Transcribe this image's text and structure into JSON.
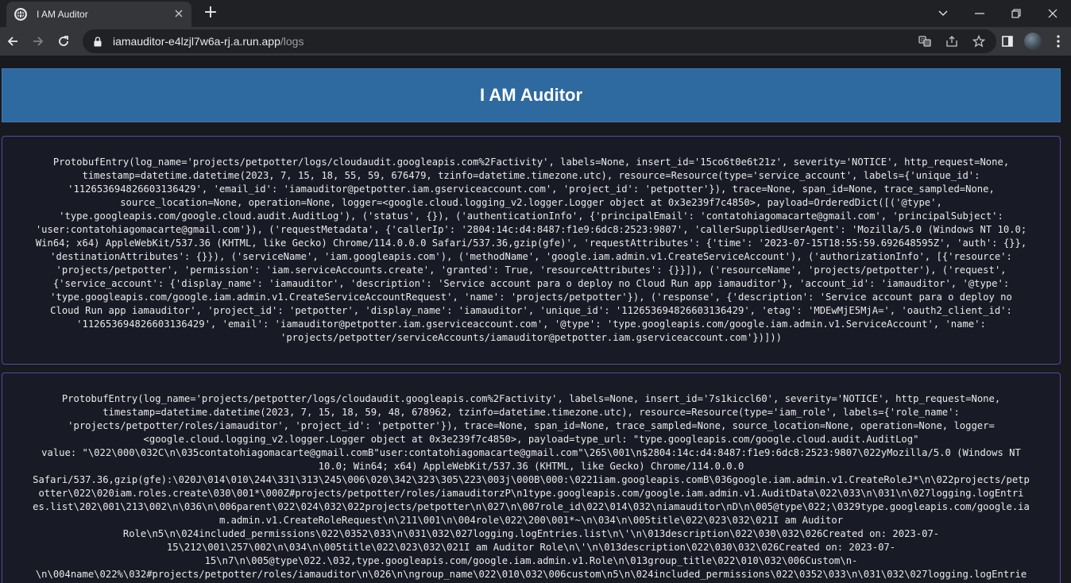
{
  "browser": {
    "tab_title": "I AM Auditor",
    "new_tab_label": "+",
    "url_host": "iamauditor-e4lzjl7w6a-rj.a.run.app",
    "url_path": "/logs"
  },
  "page": {
    "title": "I AM Auditor",
    "logs": [
      {
        "lines": [
          "ProtobufEntry(log_name='projects/petpotter/logs/cloudaudit.googleapis.com%2Factivity', labels=None, insert_id='15co6t0e6t21z', severity='NOTICE', http_request=None,",
          "timestamp=datetime.datetime(2023, 7, 15, 18, 55, 59, 676479, tzinfo=datetime.timezone.utc), resource=Resource(type='service_account', labels={'unique_id':",
          "'112653694826603136429', 'email_id': 'iamauditor@petpotter.iam.gserviceaccount.com', 'project_id': 'petpotter'}), trace=None, span_id=None, trace_sampled=None,",
          "source_location=None, operation=None, logger=<google.cloud.logging_v2.logger.Logger object at 0x3e239f7c4850>, payload=OrderedDict([('@type',",
          "'type.googleapis.com/google.cloud.audit.AuditLog'), ('status', {}), ('authenticationInfo', {'principalEmail': 'contatohiagomacarte@gmail.com', 'principalSubject':",
          "'user:contatohiagomacarte@gmail.com'}), ('requestMetadata', {'callerIp': '2804:14c:d4:8487:f1e9:6dc8:2523:9807', 'callerSuppliedUserAgent': 'Mozilla/5.0 (Windows NT 10.0;",
          "Win64; x64) AppleWebKit/537.36 (KHTML, like Gecko) Chrome/114.0.0.0 Safari/537.36,gzip(gfe)', 'requestAttributes': {'time': '2023-07-15T18:55:59.692648595Z', 'auth': {}},",
          "'destinationAttributes': {}}), ('serviceName', 'iam.googleapis.com'), ('methodName', 'google.iam.admin.v1.CreateServiceAccount'), ('authorizationInfo', [{'resource':",
          "'projects/petpotter', 'permission': 'iam.serviceAccounts.create', 'granted': True, 'resourceAttributes': {}}]), ('resourceName', 'projects/petpotter'), ('request',",
          "{'service_account': {'display_name': 'iamauditor', 'description': 'Service account para o deploy no Cloud Run app iamauditor'}, 'account_id': 'iamauditor', '@type':",
          "'type.googleapis.com/google.iam.admin.v1.CreateServiceAccountRequest', 'name': 'projects/petpotter'}), ('response', {'description': 'Service account para o deploy no",
          "Cloud Run app iamauditor', 'project_id': 'petpotter', 'display_name': 'iamauditor', 'unique_id': '112653694826603136429', 'etag': 'MDEwMjE5MjA=', 'oauth2_client_id':",
          "'112653694826603136429', 'email': 'iamauditor@petpotter.iam.gserviceaccount.com', '@type': 'type.googleapis.com/google.iam.admin.v1.ServiceAccount', 'name':",
          "'projects/petpotter/serviceAccounts/iamauditor@petpotter.iam.gserviceaccount.com'})]))"
        ]
      },
      {
        "lines": [
          "ProtobufEntry(log_name='projects/petpotter/logs/cloudaudit.googleapis.com%2Factivity', labels=None, insert_id='7s1kiccl60', severity='NOTICE', http_request=None,",
          "timestamp=datetime.datetime(2023, 7, 15, 18, 59, 48, 678962, tzinfo=datetime.timezone.utc), resource=Resource(type='iam_role', labels={'role_name':",
          "'projects/petpotter/roles/iamauditor', 'project_id': 'petpotter'}), trace=None, span_id=None, trace_sampled=None, source_location=None, operation=None, logger=",
          "<google.cloud.logging_v2.logger.Logger object at 0x3e239f7c4850>, payload=type_url: \"type.googleapis.com/google.cloud.audit.AuditLog\"",
          "value: \"\\022\\000\\032C\\n\\035contatohiagomacarte@gmail.comB\"user:contatohiagomacarte@gmail.com\"\\265\\001\\n$2804:14c:d4:8487:f1e9:6dc8:2523:9807\\022yMozilla/5.0 (Windows NT",
          "10.0; Win64; x64) AppleWebKit/537.36 (KHTML, like Gecko) Chrome/114.0.0.0",
          "Safari/537.36,gzip(gfe):\\020J\\014\\010\\244\\331\\313\\245\\006\\020\\342\\323\\305\\223\\003j\\000B\\000:\\0221iam.googleapis.comB\\036google.iam.admin.v1.CreateRoleJ*\\n\\022projects/petp",
          "otter\\022\\020iam.roles.create\\030\\001*\\000Z#projects/petpotter/roles/iamauditorzP\\n1type.googleapis.com/google.iam.admin.v1.AuditData\\022\\033\\n\\031\\n\\027logging.logEntri",
          "es.list\\202\\001\\213\\002\\n\\036\\n\\006parent\\022\\024\\032\\022projects/petpotter\\n\\027\\n\\007role_id\\022\\014\\032\\niamauditor\\nD\\n\\005@type\\022;\\0329type.googleapis.com/google.ia",
          "m.admin.v1.CreateRoleRequest\\n\\211\\001\\n\\004role\\022\\200\\001*~\\n\\034\\n\\005title\\022\\023\\032\\021I am Auditor",
          "Role\\n5\\n\\024included_permissions\\022\\0352\\033\\n\\031\\032\\027logging.logEntries.list\\n\\'\\n\\013description\\022\\030\\032\\026Created on: 2023-07-",
          "15\\212\\001\\257\\002\\n\\034\\n\\005title\\022\\023\\032\\021I am Auditor Role\\n\\'\\n\\013description\\022\\030\\032\\026Created on: 2023-07-",
          "15\\n7\\n\\005@type\\022.\\032,type.googleapis.com/google.iam.admin.v1.Role\\n\\013group_title\\022\\010\\032\\006Custom\\n-",
          "\\n\\004name\\022%\\032#projects/petpotter/roles/iamauditor\\n\\026\\n\\ngroup_name\\022\\010\\032\\006custom\\n5\\n\\024included_permissions\\022\\0352\\033\\n\\031\\032\\027logging.logEntrie"
        ]
      }
    ]
  },
  "icons": {
    "favicon": "globe-icon",
    "tab_close": "close-icon",
    "back": "arrow-left-icon",
    "forward": "arrow-right-icon",
    "reload": "reload-icon",
    "lock": "lock-icon",
    "translate": "translate-icon",
    "share": "share-icon",
    "bookmark": "star-icon",
    "sidebar": "side-panel-icon",
    "profile": "avatar",
    "menu": "kebab-menu-icon"
  },
  "colors": {
    "header_bg": "#2e6aa0",
    "card_border": "#5749a8",
    "page_bg": "#191a1f"
  }
}
